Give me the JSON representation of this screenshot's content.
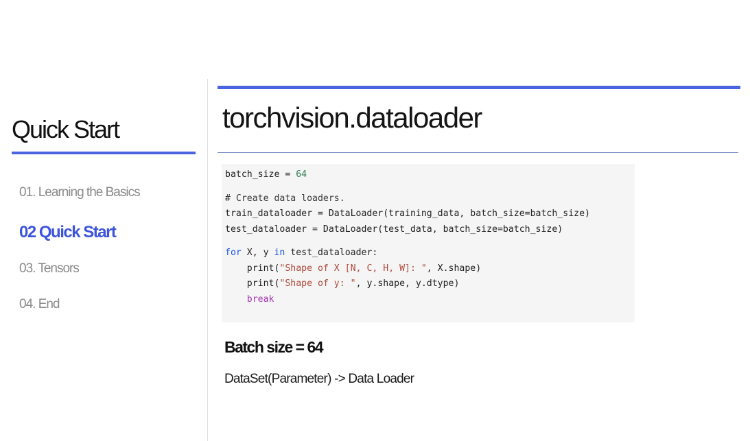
{
  "sidebar": {
    "title": "Quick Start",
    "items": [
      {
        "label": "01. Learning the Basics",
        "active": false
      },
      {
        "label": "02 Quick Start",
        "active": true
      },
      {
        "label": "03. Tensors",
        "active": false
      },
      {
        "label": "04. End",
        "active": false
      }
    ]
  },
  "slide": {
    "title": "torchvision.dataloader",
    "code": {
      "l1_a": "batch_size = ",
      "l1_b": "64",
      "l2": "# Create data loaders.",
      "l3": "train_dataloader = DataLoader(training_data, batch_size=batch_size)",
      "l4": "test_dataloader = DataLoader(test_data, batch_size=batch_size)",
      "l5_kw1": "for",
      "l5_a": " X, y ",
      "l5_kw2": "in",
      "l5_b": " test_dataloader:",
      "l6_indent": "    ",
      "l6_a": "print(",
      "l6_str": "\"Shape of X [N, C, H, W]: \"",
      "l6_b": ", X.shape)",
      "l7_indent": "    ",
      "l7_a": "print(",
      "l7_str": "\"Shape of y: \"",
      "l7_b": ", y.shape, y.dtype)",
      "l8_indent": "    ",
      "l8_kw": "break"
    },
    "subheading": "Batch size = 64",
    "body": "DataSet(Parameter) -> Data Loader"
  },
  "colors": {
    "accent": "#4a63e0",
    "active_nav": "#3d55dc",
    "inactive_nav": "#8a8a8a",
    "code_bg": "#f5f5f5"
  }
}
